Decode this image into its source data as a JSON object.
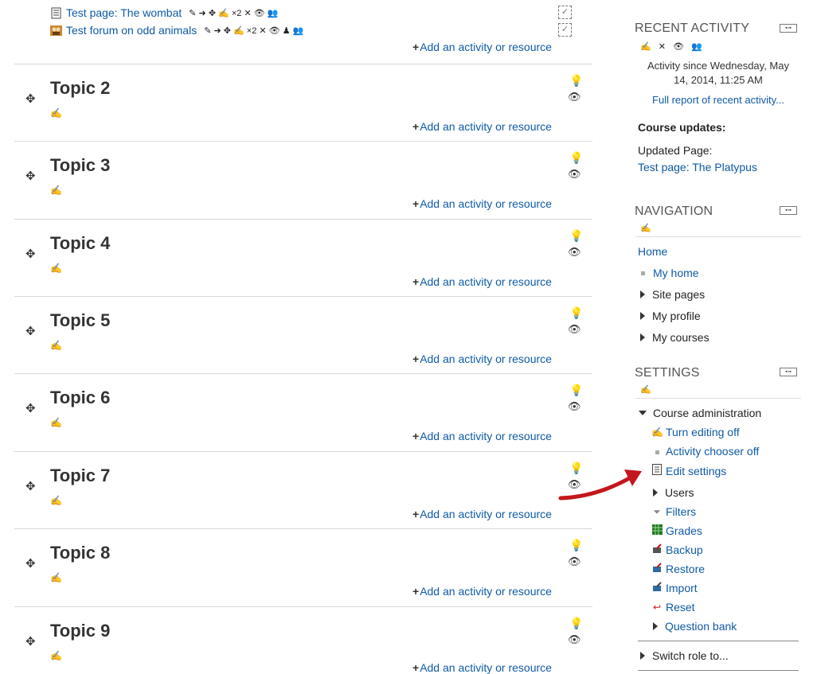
{
  "main": {
    "top_items": [
      {
        "label": "Test page: The wombat",
        "icon": "page-icon"
      },
      {
        "label": "Test forum on odd animals",
        "icon": "forum-icon"
      }
    ],
    "add_activity_label": "Add an activity or resource",
    "edit_icons_text": "✎ ➜ ✥ ✍ ×2 ✕ 👁 👥",
    "forum_edit_icons_text": "✎ ➜ ✥ ✍ ×2 ✕ 👁 ♟ 👥",
    "topics": [
      {
        "title": "Topic 2"
      },
      {
        "title": "Topic 3"
      },
      {
        "title": "Topic 4"
      },
      {
        "title": "Topic 5"
      },
      {
        "title": "Topic 6"
      },
      {
        "title": "Topic 7"
      },
      {
        "title": "Topic 8"
      },
      {
        "title": "Topic 9"
      }
    ]
  },
  "side": {
    "recent_activity": {
      "title": "RECENT ACTIVITY",
      "since": "Activity since Wednesday, May 14, 2014, 11:25 AM",
      "full_report": "Full report of recent activity...",
      "course_updates": "Course updates:",
      "updated_label": "Updated Page:",
      "updated_link": "Test page: The Platypus"
    },
    "navigation": {
      "title": "NAVIGATION",
      "home": "Home",
      "my_home": "My home",
      "site_pages": "Site pages",
      "my_profile": "My profile",
      "my_courses": "My courses"
    },
    "settings": {
      "title": "SETTINGS",
      "course_admin": "Course administration",
      "items": [
        {
          "label": "Turn editing off",
          "icon": "pencil-icon"
        },
        {
          "label": "Activity chooser off",
          "icon": "bullet-icon"
        },
        {
          "label": "Edit settings",
          "icon": "settings-page-icon"
        },
        {
          "label": "Users",
          "icon": "expand-icon"
        },
        {
          "label": "Filters",
          "icon": "filter-icon"
        },
        {
          "label": "Grades",
          "icon": "grades-icon"
        },
        {
          "label": "Backup",
          "icon": "backup-icon"
        },
        {
          "label": "Restore",
          "icon": "restore-icon"
        },
        {
          "label": "Import",
          "icon": "import-icon"
        },
        {
          "label": "Reset",
          "icon": "reset-icon"
        },
        {
          "label": "Question bank",
          "icon": "expand-icon"
        }
      ],
      "switch_role": "Switch role to..."
    }
  },
  "colors": {
    "link": "#0f5aa6",
    "arrow": "#c4161c"
  }
}
